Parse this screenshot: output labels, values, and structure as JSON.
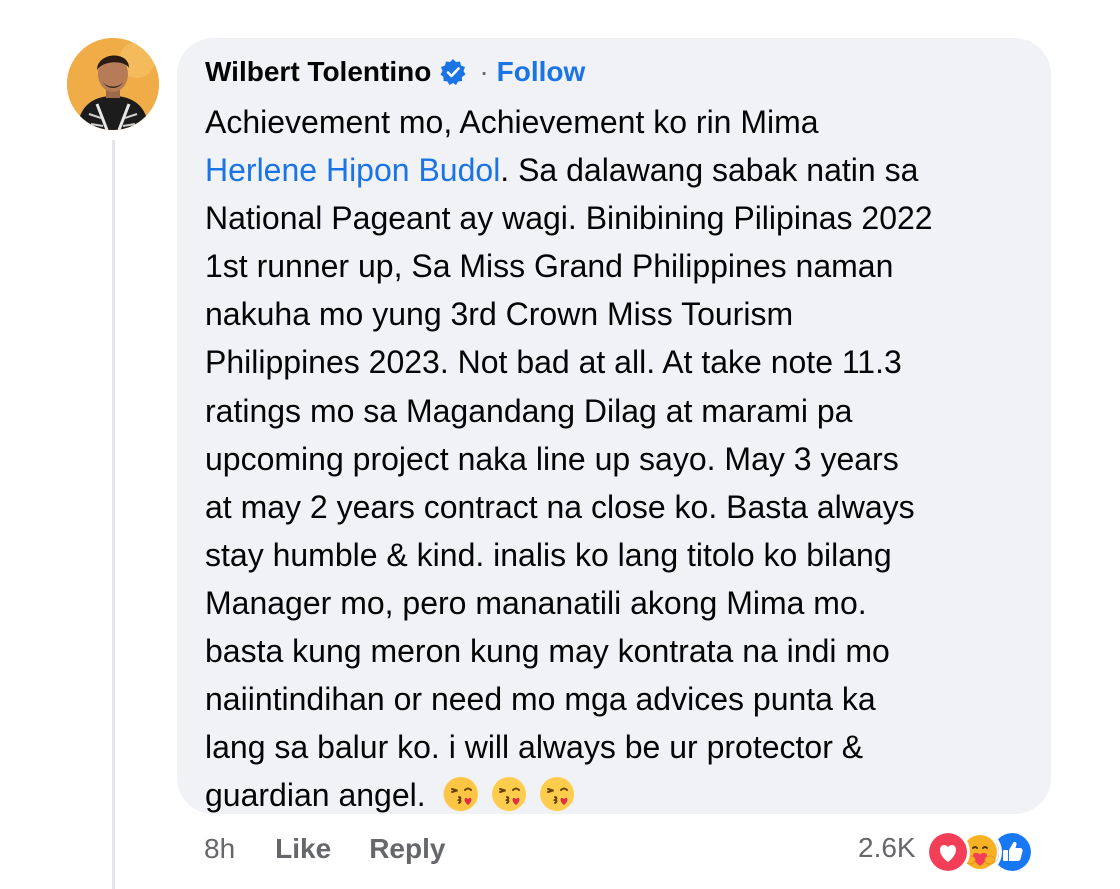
{
  "comment": {
    "author": "Wilbert Tolentino",
    "verified": true,
    "separator": "·",
    "follow_label": "Follow",
    "mention": "Herlene Hipon Budol",
    "lines": [
      "Achievement mo, Achievement ko rin Mima",
      ". Sa dalawang sabak natin sa",
      "National Pageant ay wagi. Binibining Pilipinas 2022",
      "1st runner up, Sa Miss Grand Philippines naman",
      "nakuha mo yung 3rd Crown Miss Tourism",
      "Philippines 2023. Not bad at all. At take note 11.3",
      "ratings mo sa Magandang Dilag at marami pa",
      "upcoming project naka line up sayo. May 3 years",
      "at may 2 years contract na close ko. Basta always",
      "stay humble & kind. inalis ko lang titolo ko bilang",
      "Manager mo, pero mananatili akong Mima mo.",
      "basta kung meron kung may kontrata na indi mo",
      "naiintindihan or need mo mga advices punta ka",
      "lang sa balur ko.  i will always be ur protector &",
      "guardian angel."
    ],
    "emojis": [
      "face-blowing-kiss",
      "face-blowing-kiss",
      "face-blowing-kiss"
    ]
  },
  "footer": {
    "time": "8h",
    "like_label": "Like",
    "reply_label": "Reply",
    "reaction_count": "2.6K",
    "reaction_icons": [
      "love-reaction",
      "care-reaction",
      "like-reaction"
    ]
  },
  "colors": {
    "bubble": "#f0f2f5",
    "link": "#1b74e4",
    "muted": "#65676b",
    "love": "#f33e58",
    "like": "#1877f2"
  }
}
